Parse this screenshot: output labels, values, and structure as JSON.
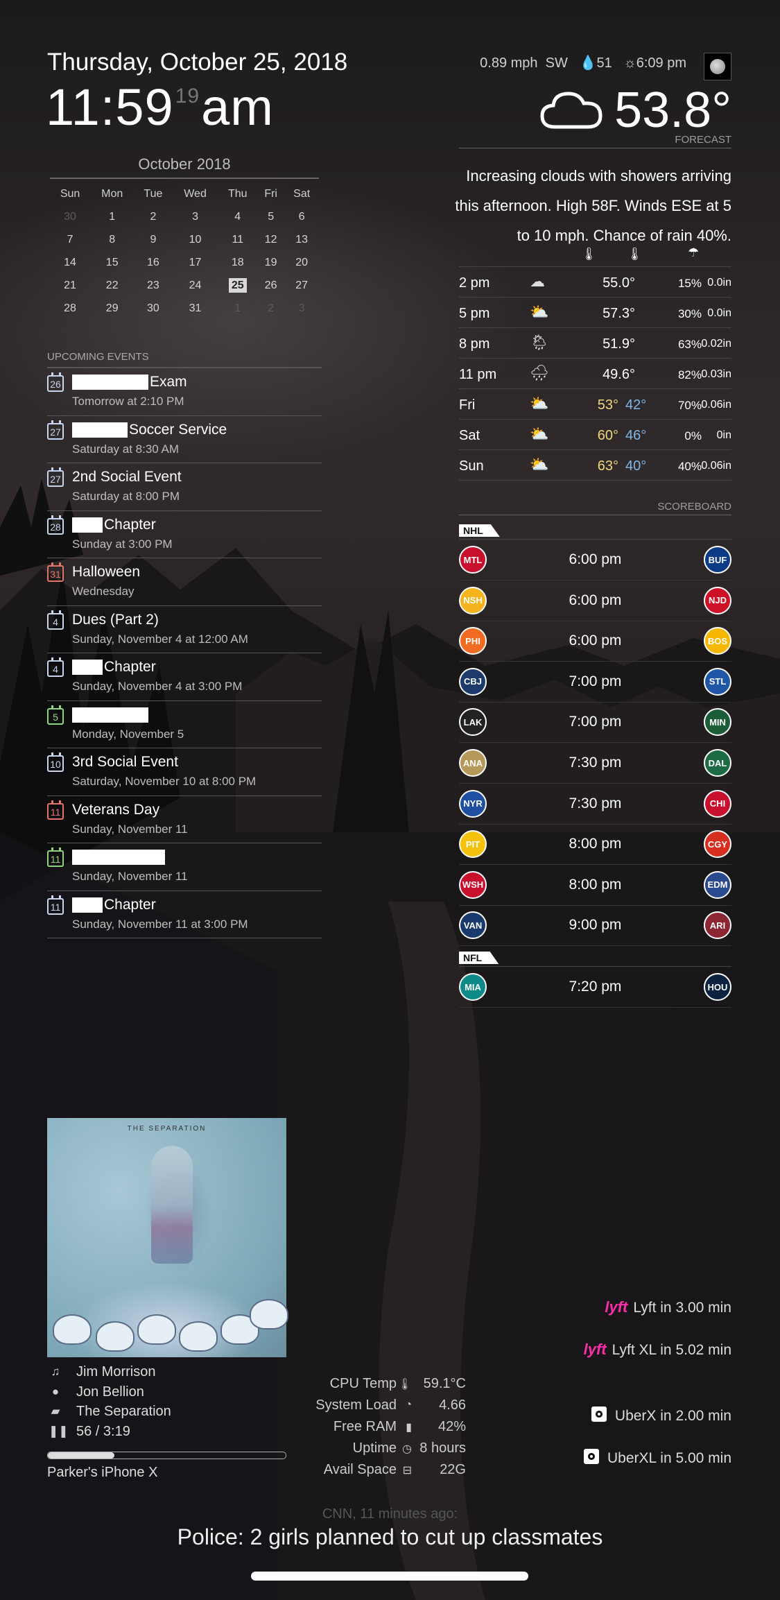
{
  "clock": {
    "date": "Thursday, October 25, 2018",
    "time_hm": "11:59",
    "time_sec": "19",
    "ampm": "am"
  },
  "calendar": {
    "month": "October 2018",
    "days_of_week": [
      "Sun",
      "Mon",
      "Tue",
      "Wed",
      "Thu",
      "Fri",
      "Sat"
    ],
    "weeks": [
      [
        "30",
        "1",
        "2",
        "3",
        "4",
        "5",
        "6"
      ],
      [
        "7",
        "8",
        "9",
        "10",
        "11",
        "12",
        "13"
      ],
      [
        "14",
        "15",
        "16",
        "17",
        "18",
        "19",
        "20"
      ],
      [
        "21",
        "22",
        "23",
        "24",
        "25",
        "26",
        "27"
      ],
      [
        "28",
        "29",
        "30",
        "31",
        "1",
        "2",
        "3"
      ]
    ],
    "today": "25"
  },
  "events": {
    "header": "UPCOMING EVENTS",
    "items": [
      {
        "day": "26",
        "title": "Exam",
        "redacted": true,
        "sub": "Tomorrow at 2:10 PM",
        "color": "#c8d6f0"
      },
      {
        "day": "27",
        "title": "Soccer Service",
        "redacted": true,
        "sub": "Saturday at 8:30 AM",
        "color": "#c8d6f0"
      },
      {
        "day": "27",
        "title": "2nd Social Event",
        "redacted": false,
        "sub": "Saturday at 8:00 PM",
        "color": "#c8d6f0"
      },
      {
        "day": "28",
        "title": "Chapter",
        "redacted": true,
        "sub": "Sunday at 3:00 PM",
        "color": "#c8d6f0"
      },
      {
        "day": "31",
        "title": "Halloween",
        "redacted": false,
        "sub": "Wednesday",
        "color": "#e2746c"
      },
      {
        "day": "4",
        "title": "Dues (Part 2)",
        "redacted": false,
        "sub": "Sunday, November 4 at 12:00 AM",
        "color": "#c8d6f0"
      },
      {
        "day": "4",
        "title": "Chapter",
        "redacted": true,
        "sub": "Sunday, November 4 at 3:00 PM",
        "color": "#c8d6f0"
      },
      {
        "day": "5",
        "title": "",
        "redacted": true,
        "sub": "Monday, November 5",
        "color": "#8fd67a"
      },
      {
        "day": "10",
        "title": "3rd Social Event",
        "redacted": false,
        "sub": "Saturday, November 10 at 8:00 PM",
        "color": "#c8d6f0"
      },
      {
        "day": "11",
        "title": "Veterans Day",
        "redacted": false,
        "sub": "Sunday, November 11",
        "color": "#e2746c"
      },
      {
        "day": "11",
        "title": "",
        "redacted": true,
        "sub": "Sunday, November 11",
        "color": "#8fd67a"
      },
      {
        "day": "11",
        "title": "Chapter",
        "redacted": true,
        "sub": "Sunday, November 11 at 3:00 PM",
        "color": "#c8d6f0"
      }
    ]
  },
  "weather": {
    "wind": "0.89 mph",
    "wind_dir": "SW",
    "humidity": "51",
    "sunset": "6:09 pm",
    "current_temp": "53.8°",
    "forecast_label": "FORECAST",
    "summary": "Increasing clouds with showers arriving this afternoon. High 58F. Winds ESE at 5 to 10 mph. Chance of rain 40%.",
    "rows": [
      {
        "time": "2 pm",
        "icon": "cloud-icon",
        "high": "55.0°",
        "low": "",
        "pop": "15%",
        "precip": "0.0in"
      },
      {
        "time": "5 pm",
        "icon": "partly-sunny-icon",
        "high": "57.3°",
        "low": "",
        "pop": "30%",
        "precip": "0.0in"
      },
      {
        "time": "8 pm",
        "icon": "showers-icon",
        "high": "51.9°",
        "low": "",
        "pop": "63%",
        "precip": "0.02in"
      },
      {
        "time": "11 pm",
        "icon": "rain-icon",
        "high": "49.6°",
        "low": "",
        "pop": "82%",
        "precip": "0.03in"
      },
      {
        "time": "Fri",
        "icon": "partly-sunny-icon",
        "high": "53°",
        "low": "42°",
        "pop": "70%",
        "precip": "0.06in"
      },
      {
        "time": "Sat",
        "icon": "partly-sunny-icon",
        "high": "60°",
        "low": "46°",
        "pop": "0%",
        "precip": "0in"
      },
      {
        "time": "Sun",
        "icon": "partly-sunny-icon",
        "high": "63°",
        "low": "40°",
        "pop": "40%",
        "precip": "0.06in"
      }
    ]
  },
  "scoreboard": {
    "label": "SCOREBOARD",
    "leagues": [
      {
        "name": "NHL",
        "games": [
          {
            "away": "MTL",
            "home": "BUF",
            "time": "6:00 pm",
            "away_color": "#c8102e",
            "home_color": "#0b3b86"
          },
          {
            "away": "NSH",
            "home": "NJD",
            "time": "6:00 pm",
            "away_color": "#f5b41e",
            "home_color": "#ce1126"
          },
          {
            "away": "PHI",
            "home": "BOS",
            "time": "6:00 pm",
            "away_color": "#f26b22",
            "home_color": "#f7b600"
          },
          {
            "away": "CBJ",
            "home": "STL",
            "time": "7:00 pm",
            "away_color": "#1c3a6b",
            "home_color": "#1f56a8"
          },
          {
            "away": "LAK",
            "home": "MIN",
            "time": "7:00 pm",
            "away_color": "#222222",
            "home_color": "#1b5d36"
          },
          {
            "away": "ANA",
            "home": "DAL",
            "time": "7:30 pm",
            "away_color": "#b5985a",
            "home_color": "#1d6b45"
          },
          {
            "away": "NYR",
            "home": "CHI",
            "time": "7:30 pm",
            "away_color": "#1f4fa0",
            "home_color": "#c8102e"
          },
          {
            "away": "PIT",
            "home": "CGY",
            "time": "8:00 pm",
            "away_color": "#f4c20d",
            "home_color": "#d62e20"
          },
          {
            "away": "WSH",
            "home": "EDM",
            "time": "8:00 pm",
            "away_color": "#c8102e",
            "home_color": "#2a4a8f"
          },
          {
            "away": "VAN",
            "home": "ARI",
            "time": "9:00 pm",
            "away_color": "#1a3a6e",
            "home_color": "#8c2633"
          }
        ]
      },
      {
        "name": "NFL",
        "games": [
          {
            "away": "MIA",
            "home": "HOU",
            "time": "7:20 pm",
            "away_color": "#0e8a8a",
            "home_color": "#0b2341"
          }
        ]
      }
    ]
  },
  "album": {
    "art_title": "THE SEPARATION"
  },
  "music": {
    "artist": "Jim Morrison",
    "album_artist": "Jon Bellion",
    "album": "The Separation",
    "position": "56 / 3:19",
    "progress": 0.28,
    "device": "Parker's iPhone X"
  },
  "system": [
    {
      "label": "CPU Temp",
      "icon": "thermometer-icon",
      "value": "59.1°C"
    },
    {
      "label": "System Load",
      "icon": "gauge-icon",
      "value": "4.66"
    },
    {
      "label": "Free RAM",
      "icon": "memory-icon",
      "value": "42%"
    },
    {
      "label": "Uptime",
      "icon": "clock-icon",
      "value": "8 hours"
    },
    {
      "label": "Avail Space",
      "icon": "disk-icon",
      "value": "22G"
    }
  ],
  "rides": [
    {
      "brand": "lyft",
      "text": "Lyft in 3.00 min"
    },
    {
      "brand": "lyft",
      "text": "Lyft XL in 5.02 min"
    },
    {
      "brand": "uber",
      "text": "UberX in 2.00 min"
    },
    {
      "brand": "uber",
      "text": "UberXL in 5.00 min"
    }
  ],
  "news": {
    "source": "CNN, 11 minutes ago:",
    "headline": "Police: 2 girls planned to cut up classmates"
  }
}
